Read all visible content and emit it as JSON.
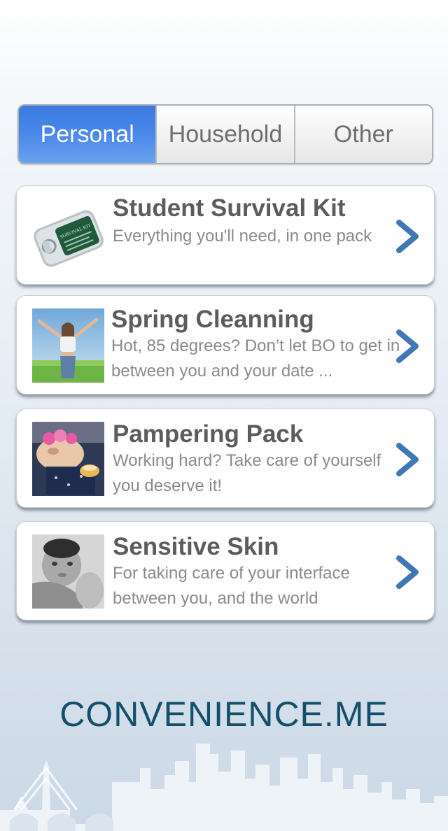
{
  "segments": {
    "personal": "Personal",
    "household": "Household",
    "other": "Other",
    "selected": "Personal"
  },
  "items": [
    {
      "title": "Student Survival Kit",
      "description": "Everything you'll need, in one pack",
      "thumbnail": "survival-kit-can"
    },
    {
      "title": "Spring Cleanning",
      "description": "Hot, 85 degrees? Don’t let BO to get in between you and your date ...",
      "thumbnail": "woman-in-field"
    },
    {
      "title": "Pampering Pack",
      "description": "Working hard? Take care of yourself  you deserve it!",
      "thumbnail": "bulldog-with-curlers"
    },
    {
      "title": "Sensitive Skin",
      "description": "For taking care of your interface between you, and the world",
      "thumbnail": "baby-portrait"
    }
  ],
  "brand": "CONVENIENCE.ME",
  "colors": {
    "accent": "#4a88ea",
    "chevron": "#3f78b5",
    "brand": "#134f6b"
  }
}
